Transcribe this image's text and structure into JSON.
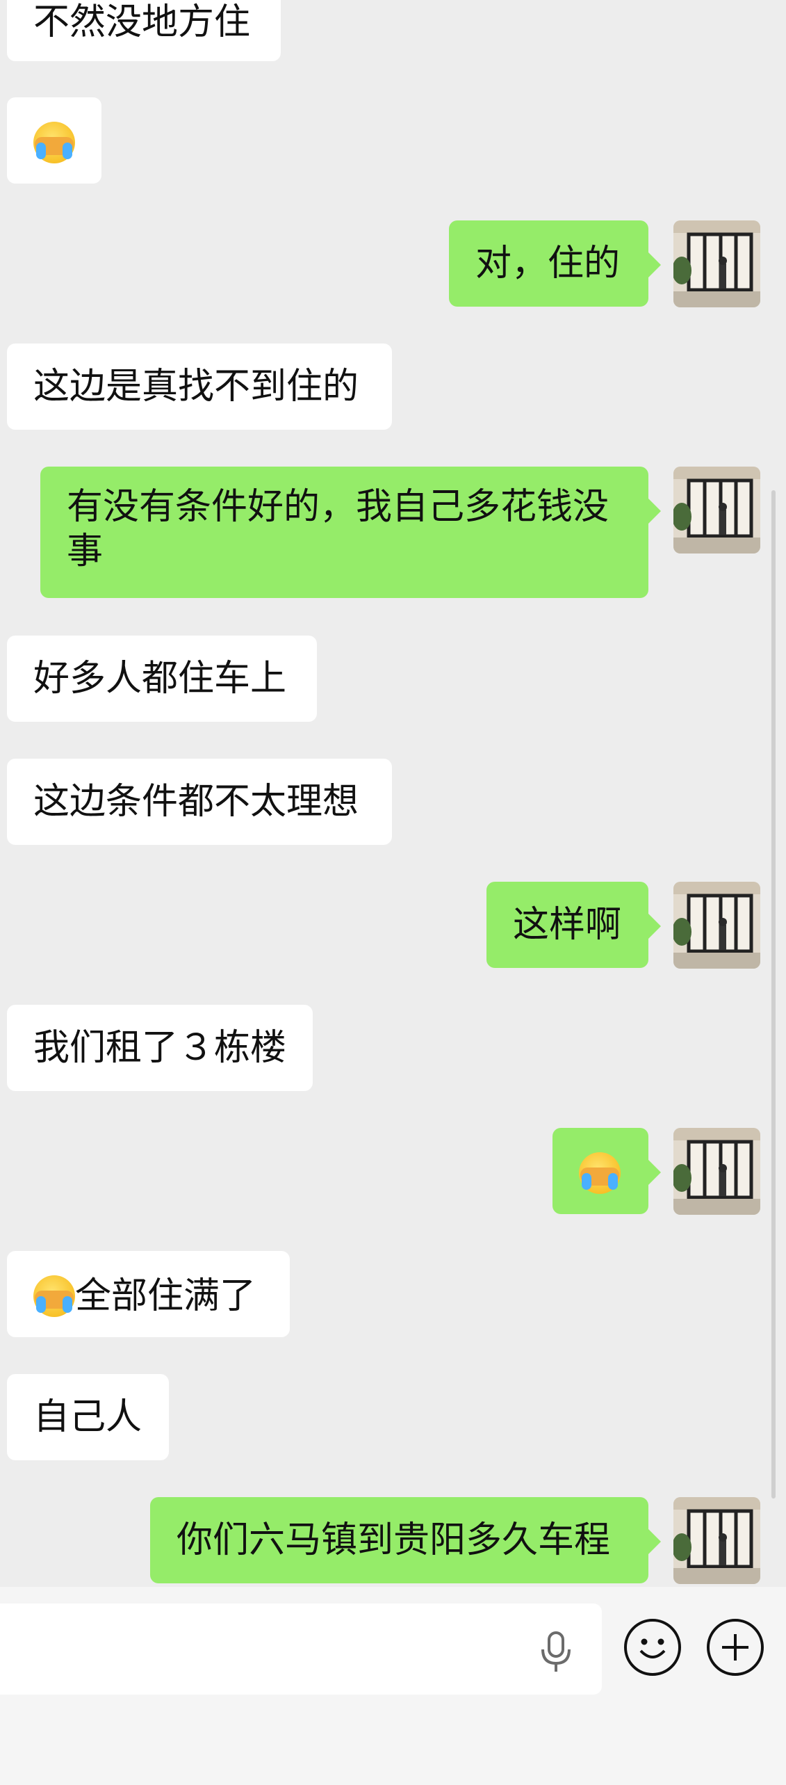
{
  "messages": [
    {
      "side": "left",
      "text": "不然没地方住"
    },
    {
      "side": "left",
      "emoji": "face-palm-tears-emoji"
    },
    {
      "side": "right",
      "text": "对，住的"
    },
    {
      "side": "left",
      "text": "这边是真找不到住的"
    },
    {
      "side": "right",
      "text": "有没有条件好的，我自己多花钱没事"
    },
    {
      "side": "left",
      "text": "好多人都住车上"
    },
    {
      "side": "left",
      "text": "这边条件都不太理想"
    },
    {
      "side": "right",
      "text": "这样啊"
    },
    {
      "side": "left",
      "text": "我们租了３栋楼"
    },
    {
      "side": "right",
      "emoji": "face-palm-tears-emoji"
    },
    {
      "side": "left",
      "text": "全部住满了",
      "emoji": "face-palm-tears-emoji"
    },
    {
      "side": "left",
      "text": "自己人"
    },
    {
      "side": "right",
      "text": "你们六马镇到贵阳多久车程"
    }
  ],
  "input": {
    "placeholder": ""
  },
  "icons": {
    "voice": "microphone-icon",
    "emoji": "smiley-icon",
    "more": "plus-icon"
  },
  "colors": {
    "background": "#ededed",
    "sent_bubble": "#95ec69",
    "received_bubble": "#ffffff"
  }
}
